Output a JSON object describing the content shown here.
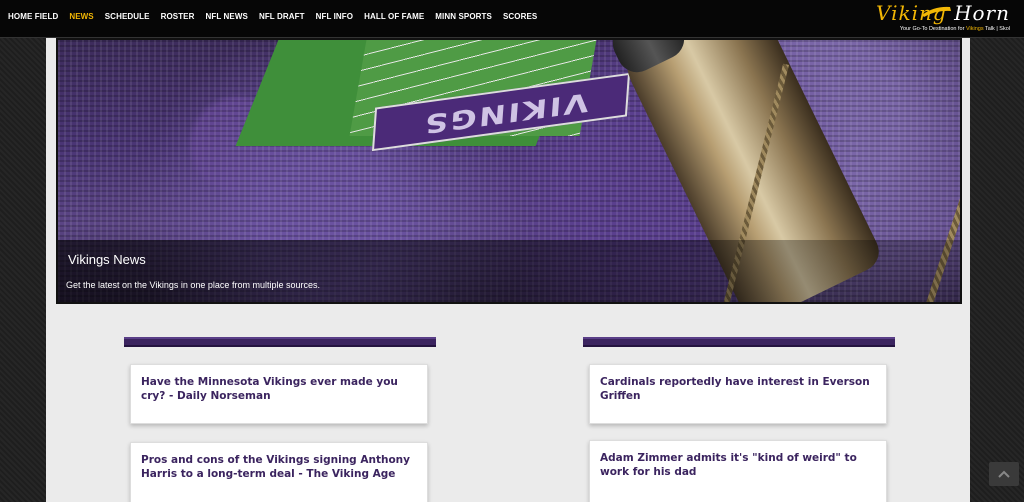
{
  "nav": {
    "items": [
      {
        "label": "HOME FIELD",
        "active": false
      },
      {
        "label": "NEWS",
        "active": true
      },
      {
        "label": "SCHEDULE",
        "active": false
      },
      {
        "label": "ROSTER",
        "active": false
      },
      {
        "label": "NFL NEWS",
        "active": false
      },
      {
        "label": "NFL DRAFT",
        "active": false
      },
      {
        "label": "NFL INFO",
        "active": false
      },
      {
        "label": "HALL OF FAME",
        "active": false
      },
      {
        "label": "MINN SPORTS",
        "active": false
      },
      {
        "label": "SCORES",
        "active": false
      }
    ]
  },
  "logo": {
    "first": "Viking",
    "second": "Horn",
    "tagline_prefix": "Your Go-To Destination for",
    "tagline_highlight": "Vikings",
    "tagline_suffix": "Talk | Skol"
  },
  "hero": {
    "endzone_text": "VIKINGS",
    "title": "Vikings News",
    "subtitle": "Get the latest on the Vikings in one place from multiple sources."
  },
  "articles": {
    "left": [
      {
        "title": "Have the Minnesota Vikings ever made you cry? - Daily Norseman"
      },
      {
        "title": "Pros and cons of the Vikings signing Anthony Harris to a long-term deal - The Viking Age"
      }
    ],
    "right": [
      {
        "title": "Cardinals reportedly have interest in Everson Griffen"
      },
      {
        "title": "Adam Zimmer admits it's \"kind of weird\" to work for his dad"
      }
    ]
  },
  "colors": {
    "accent": "#f2b705",
    "purple": "#3b245f",
    "nav_bg": "#060606"
  }
}
